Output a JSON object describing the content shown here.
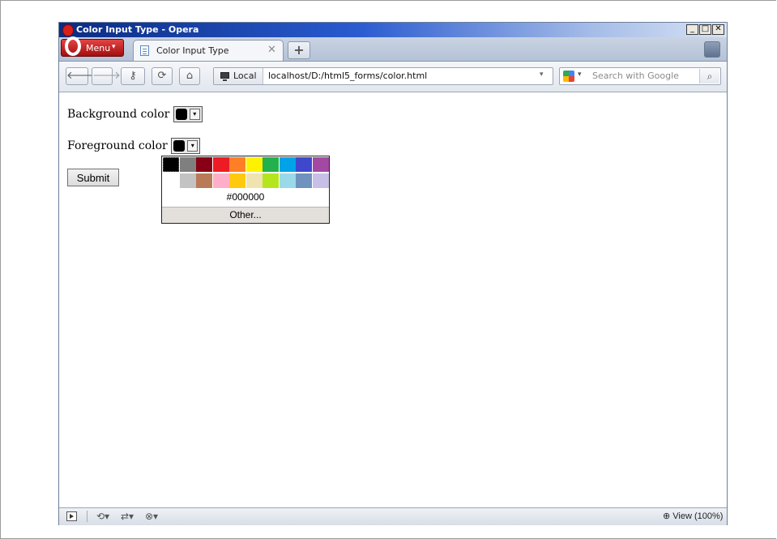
{
  "window": {
    "title": "Color Input Type - Opera",
    "controls": {
      "minimize": "_",
      "maximize": "□",
      "close": "✕"
    }
  },
  "tabstrip": {
    "menu_label": "Menu",
    "menu_chevron": "▾",
    "tab_label": "Color Input Type",
    "tab_close": "✕",
    "new_tab": "+"
  },
  "addressbar": {
    "back": "🡐",
    "forward": "🡒",
    "key": "⚷",
    "reload": "⟳",
    "home": "⌂",
    "local_label": "Local",
    "url": "localhost/D:/html5_forms/color.html",
    "url_dropdown": "▾",
    "search_engine_dropdown": "▾",
    "search_placeholder": "Search with Google",
    "search_button": "⌕"
  },
  "form": {
    "background_label": "Background color",
    "foreground_label": "Foreground color",
    "submit_label": "Submit",
    "picker_arrow": "▾",
    "background_value": "#000000",
    "foreground_value": "#000000"
  },
  "palette": {
    "row1": [
      "#000000",
      "#7f7f7f",
      "#880015",
      "#ed1c24",
      "#ff7f27",
      "#fff200",
      "#22b14c",
      "#00a2e8",
      "#3f48cc",
      "#a349a4"
    ],
    "row2": [
      "#ffffff",
      "#c3c3c3",
      "#b97a57",
      "#ffaec9",
      "#ffc90e",
      "#efe4b0",
      "#b5e61d",
      "#99d9ea",
      "#7092be",
      "#c8bfe7"
    ],
    "selected_index": 0,
    "hex_value": "#000000",
    "other_label": "Other..."
  },
  "statusbar": {
    "sync_icon": "⟲▾",
    "share_icon": "⇄▾",
    "turbo_icon": "⊗▾",
    "view_icon": "⊕",
    "view_label": "View (100%)"
  }
}
